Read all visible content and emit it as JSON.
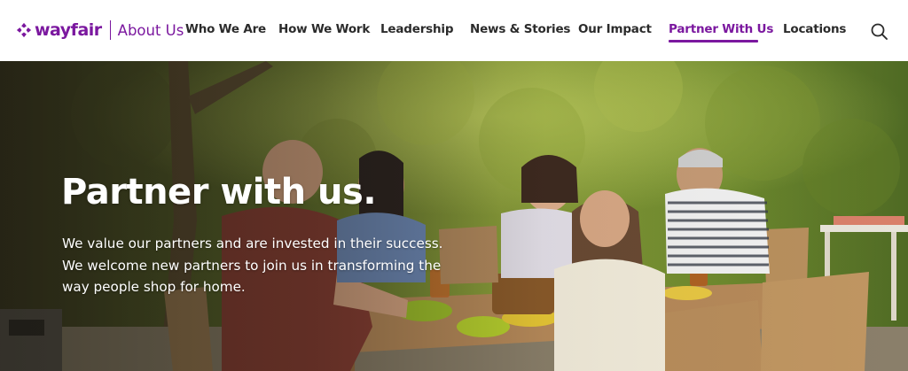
{
  "brand": {
    "logo_text": "wayfair",
    "section_title": "About Us"
  },
  "nav": {
    "items": [
      {
        "label": "Who We Are",
        "active": false
      },
      {
        "label": "How We Work",
        "active": false
      },
      {
        "label": "Leadership",
        "active": false
      },
      {
        "label": "News & Stories",
        "active": false
      },
      {
        "label": "Our Impact",
        "active": false
      },
      {
        "label": "Partner With Us",
        "active": true
      },
      {
        "label": "Locations",
        "active": false
      }
    ],
    "search_icon": "search-icon"
  },
  "hero": {
    "title": "Partner with us.",
    "body_lines": [
      "We value our partners and are invested in their success.",
      "We welcome new partners to join us in transforming the",
      "way people shop for home."
    ]
  },
  "colors": {
    "brand_purple": "#7b189f",
    "nav_text": "#2b2b2b",
    "hero_text": "#ffffff"
  }
}
